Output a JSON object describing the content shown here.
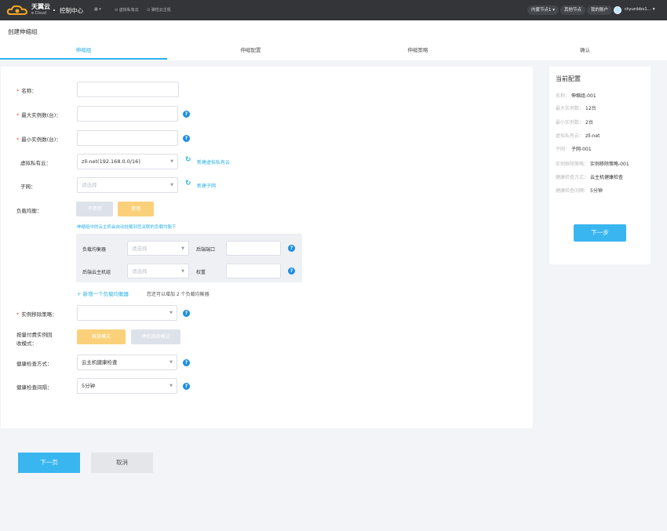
{
  "header": {
    "logo_text": "天翼云",
    "logo_sub": "e Cloud",
    "console": "控制中心",
    "shortcuts": [
      "虚拟私有云",
      "弹性云主机"
    ],
    "region": "内蒙节点1",
    "other_nodes": "其他节点",
    "account": "我的账户",
    "user": "ctyunbbs1..."
  },
  "page": {
    "title": "创建伸缩组",
    "steps": [
      "伸缩组",
      "伸缩配置",
      "伸缩策略",
      "确认"
    ],
    "active_step": 0
  },
  "form": {
    "name_label": "名称：",
    "max_label": "最大实例数(台)：",
    "min_label": "最小实例数(台)：",
    "vpc_label": "虚拟私有云：",
    "vpc_value": "zll-net(192.168.0.0/16)",
    "vpc_link": "新建虚拟私有云",
    "subnet_label": "子网：",
    "subnet_placeholder": "请选择",
    "subnet_link": "新建子网",
    "lb_label": "负载均衡：",
    "lb_no": "不使用",
    "lb_yes": "使用",
    "lb_hint": "伸缩组中的云主机会自动挂载到您关联的负载均衡下",
    "lb_balancer": "负载均衡器",
    "lb_balancer_ph": "请选择",
    "lb_backend_port": "后端端口",
    "lb_backend_group": "后端云主机组",
    "lb_group_ph": "请选择",
    "lb_weight": "权重",
    "lb_add": "新增一个负载均衡器",
    "lb_add_note": "您还可以增加 2 个负载均衡器",
    "removal_label": "实例移除策略：",
    "recycle_label_1": "按量付费实例回",
    "recycle_label_2": "收模式：",
    "recycle_release": "释放模式",
    "recycle_stop": "停机回收模式",
    "health_label": "健康检查方式：",
    "health_value": "云主机健康检查",
    "interval_label": "健康检查间隔：",
    "interval_value": "5分钟"
  },
  "summary": {
    "title": "当前配置",
    "items": [
      {
        "k": "名称：",
        "v": "伸缩组-001"
      },
      {
        "k": "最大实例数：",
        "v": "12台"
      },
      {
        "k": "最小实例数：",
        "v": "2台"
      },
      {
        "k": "虚拟私有云：",
        "v": "zll-net"
      },
      {
        "k": "子网：",
        "v": "子网-001"
      },
      {
        "k": "实例移除策略：",
        "v": "实例移除策略-001"
      },
      {
        "k": "健康检查方式：",
        "v": "云主机健康检查"
      },
      {
        "k": "健康检查间隔：",
        "v": "5分钟"
      }
    ],
    "next": "下一步"
  },
  "footer": {
    "next": "下一页",
    "cancel": "取消"
  }
}
